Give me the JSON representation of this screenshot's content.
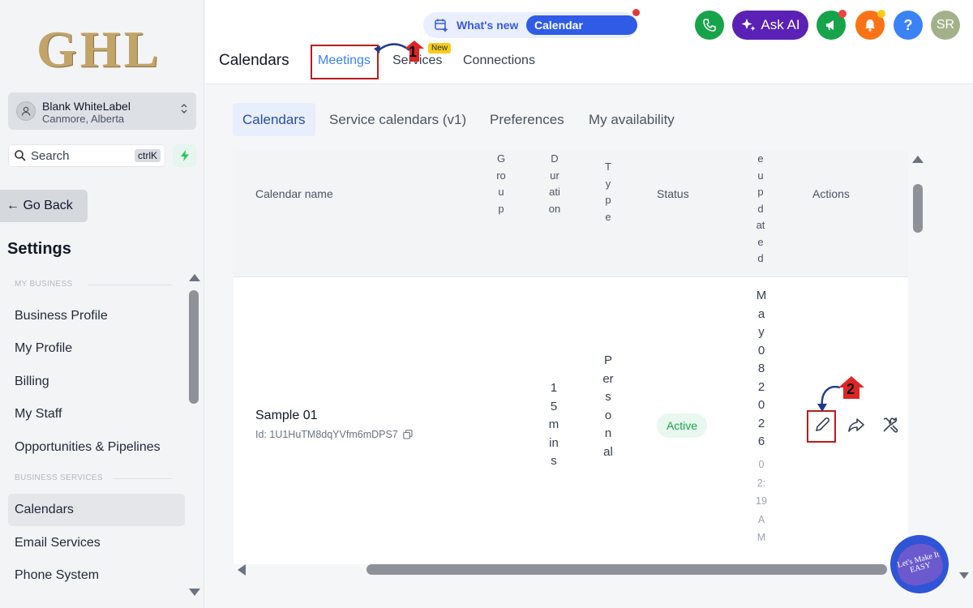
{
  "sidebar": {
    "logo_text": "GHL",
    "account": {
      "name": "Blank WhiteLabel",
      "location": "Canmore, Alberta"
    },
    "search": {
      "label": "Search",
      "shortcut": "ctrlK"
    },
    "go_back_label": "← Go Back",
    "settings_title": "Settings",
    "section_my_business": "MY BUSINESS",
    "section_business_services": "BUSINESS SERVICES",
    "items": [
      {
        "label": "Business Profile"
      },
      {
        "label": "My Profile"
      },
      {
        "label": "Billing"
      },
      {
        "label": "My Staff"
      },
      {
        "label": "Opportunities & Pipelines"
      },
      {
        "label": "Calendars",
        "active": true
      },
      {
        "label": "Email Services"
      },
      {
        "label": "Phone System"
      }
    ]
  },
  "header": {
    "whats_new_label": "What's new",
    "calendar_updates_label": "Calendar Updates",
    "ask_ai_label": "Ask AI",
    "help_label": "?",
    "avatar_initials": "SR",
    "page_title": "Calendars",
    "tabs": [
      {
        "label": "Meetings",
        "active": true
      },
      {
        "label": "Services",
        "badge": "New"
      },
      {
        "label": "Connections"
      }
    ]
  },
  "subtabs": [
    {
      "label": "Calendars",
      "active": true
    },
    {
      "label": "Service calendars (v1)"
    },
    {
      "label": "Preferences"
    },
    {
      "label": "My availability"
    }
  ],
  "table": {
    "columns": {
      "calendar_name": "Calendar name",
      "group": "Group",
      "duration": "Duration",
      "type": "Type",
      "status": "Status",
      "updated": "eupdated",
      "actions": "Actions"
    },
    "rows": [
      {
        "name": "Sample 01",
        "id": "Id: 1U1HuTM8dqYVfm6mDPS7",
        "duration": "15mins",
        "type": "Personal",
        "status": "Active",
        "updated_date": "May082026",
        "updated_time": "02:19AM"
      }
    ]
  },
  "annotations": {
    "step1": "1",
    "step2": "2"
  },
  "bubble_text": "Let's Make It EASY",
  "colors": {
    "accent": "#3b82f6",
    "annotation_red": "#b91c1c",
    "status_green": "#16a34a",
    "ask_ai_purple": "#5b21b6",
    "phone_green": "#16a34a",
    "bell_orange": "#f97316",
    "help_blue": "#3b82f6",
    "avatar_olive": "#a3b18a"
  }
}
